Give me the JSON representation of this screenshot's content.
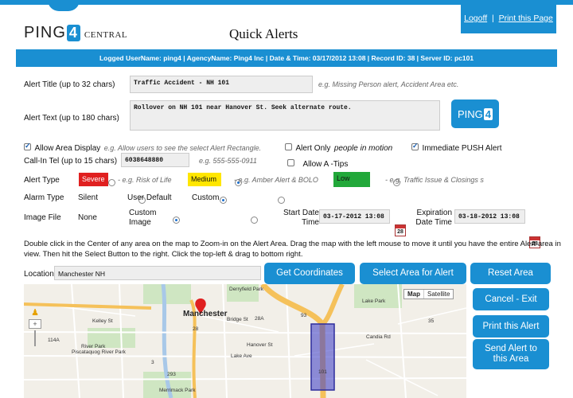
{
  "header": {
    "logo_main": "PING",
    "logo_four": "4",
    "logo_sub": "CENTRAL",
    "page_title": "Quick Alerts",
    "logoff": "Logoff",
    "separator": "|",
    "print_page": "Print this Page"
  },
  "infobar": {
    "text": "Logged UserName: ping4  |  AgencyName: Ping4 Inc  |  Date & Time: 03/17/2012 13:08  |  Record ID: 38  |  Server ID: pc101"
  },
  "form": {
    "alert_title_label": "Alert Title (up to 32 chars)",
    "alert_title_value": "Traffic Accident - NH 101",
    "alert_title_hint": "e.g. Missing Person alert, Accident Area etc.",
    "alert_text_label": "Alert Text (up to 180 chars)",
    "alert_text_value": "Rollover on NH 101 near Hanover St. Seek alternate route.",
    "allow_area_label": "Allow Area Display",
    "allow_area_hint": "e.g. Allow users to see the select Alert Rectangle.",
    "alert_only_label": "Alert Only",
    "alert_only_emph": "people in motion",
    "immediate_push_label": "Immediate PUSH Alert",
    "callin_label": "Call-In Tel (up to 15 chars)",
    "callin_value": "6038648880",
    "callin_hint": "e.g. 555-555-0911",
    "allow_tips_label": "Allow A -Tips",
    "alert_type_label": "Alert Type",
    "severe_label": "Severe",
    "severe_hint": "- e.g. Risk of Life",
    "medium_label": "Medium",
    "medium_hint": "- e.g. Amber Alert & BOLO",
    "low_label": "Low",
    "low_hint": "- e.g. Traffic Issue & Closings s",
    "alarm_type_label": "Alarm Type",
    "silent_label": "Silent",
    "user_default_label": "User Default",
    "custom_label": "Custom",
    "image_file_label": "Image File",
    "none_label": "None",
    "custom_image_label": "Custom Image",
    "start_date_label": "Start Date Time",
    "start_date_value": "03-17-2012 13:08",
    "expiration_label": "Expiration Date Time",
    "expiration_value": "03-18-2012 13:08",
    "calendar_glyph": "28"
  },
  "instructions": "Double click in the Center of any area on the map to Zoom-in on the Alert Area. Drag the map with the left mouse to move it until you have the entire Alert area in view. Then hit the Select Button to the right. Click the top-left & drag to bottom right.",
  "location": {
    "label": "Location",
    "value": "Manchester NH"
  },
  "buttons": {
    "get_coordinates": "Get Coordinates",
    "select_area": "Select Area for Alert",
    "reset_area": "Reset Area",
    "cancel_exit": "Cancel - Exit",
    "print_alert": "Print this Alert",
    "send_alert": "Send Alert to this Area"
  },
  "map": {
    "map_btn": "Map",
    "satellite_btn": "Satellite",
    "labels": {
      "manchester": "Manchester",
      "kelley": "Kelley St",
      "river_park": "River Park",
      "piscataquog": "Piscataquog River Park",
      "bridge": "Bridge St",
      "hanover": "Hanover St",
      "lake_ave": "Lake Ave",
      "candia": "Candia Rd",
      "lake_park": "Lake Park",
      "derryfield": "Derryfield Park",
      "merrimack": "Merrimack Park",
      "rt28": "28",
      "rt28a": "28A",
      "rt93": "93",
      "rt101": "101",
      "rt114a": "114A",
      "rt3": "3",
      "rt293": "293",
      "rt35": "35"
    },
    "colors": {
      "highway": "#f5c15a",
      "area": "#4646c8",
      "pin": "#e02020"
    }
  },
  "colors": {
    "accent": "#1a8fd2",
    "severe": "#e02020",
    "medium": "#ffe600",
    "low": "#22a83a"
  }
}
